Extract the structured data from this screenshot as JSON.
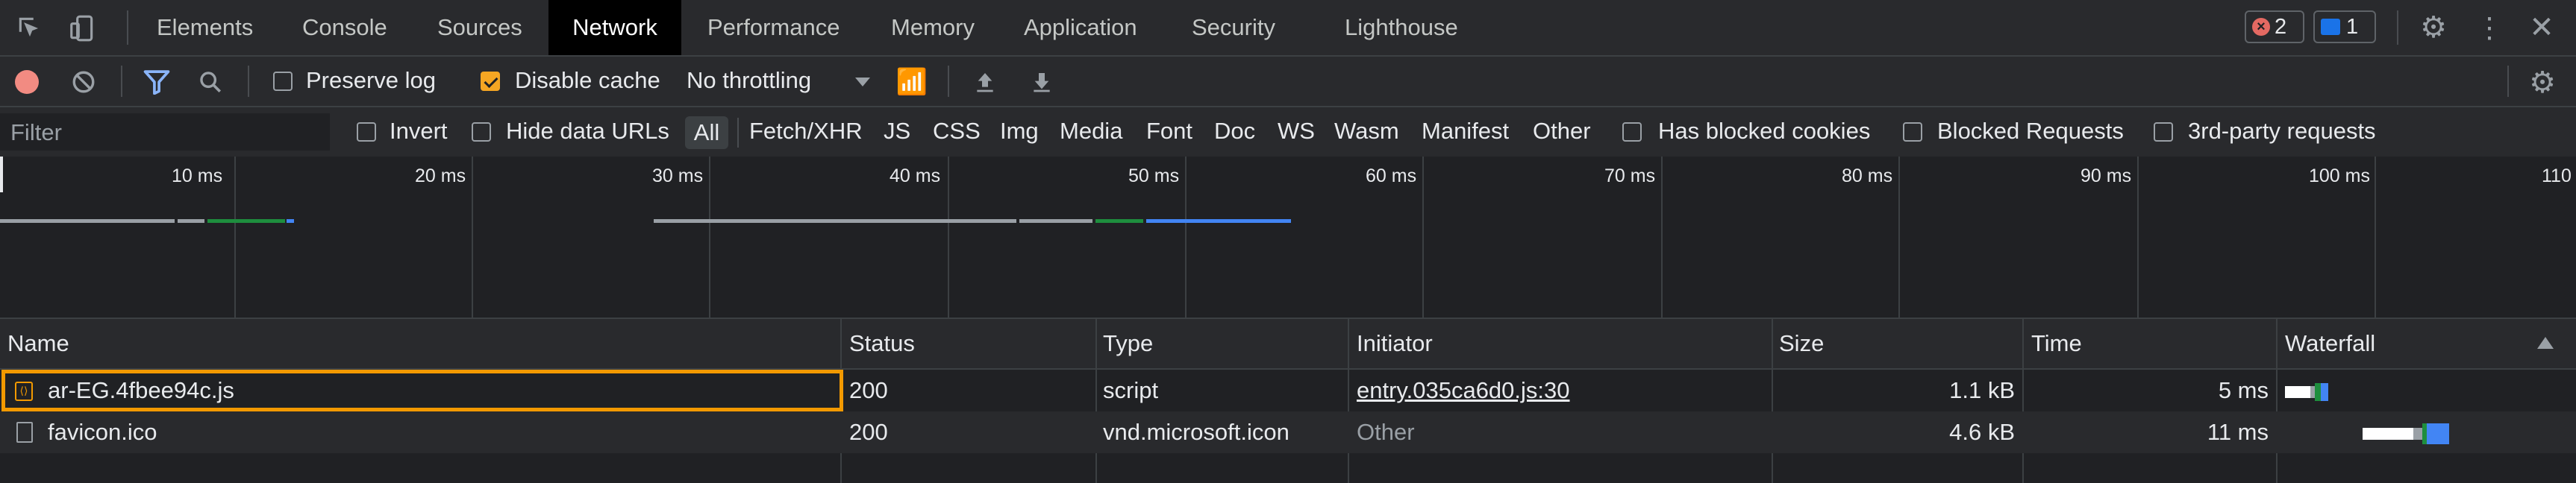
{
  "tabs": [
    "Elements",
    "Console",
    "Sources",
    "Network",
    "Performance",
    "Memory",
    "Application",
    "Security",
    "Lighthouse"
  ],
  "active_tab": "Network",
  "badges": {
    "errors": "2",
    "messages": "1"
  },
  "toolbar": {
    "preserve_log": "Preserve log",
    "disable_cache": "Disable cache",
    "throttling": "No throttling"
  },
  "filterbar": {
    "filter_placeholder": "Filter",
    "invert": "Invert",
    "hide_data_urls": "Hide data URLs",
    "types": [
      "All",
      "Fetch/XHR",
      "JS",
      "CSS",
      "Img",
      "Media",
      "Font",
      "Doc",
      "WS",
      "Wasm",
      "Manifest",
      "Other"
    ],
    "has_blocked_cookies": "Has blocked cookies",
    "blocked_requests": "Blocked Requests",
    "third_party": "3rd-party requests"
  },
  "overview": {
    "ticks": [
      "10 ms",
      "20 ms",
      "30 ms",
      "40 ms",
      "50 ms",
      "60 ms",
      "70 ms",
      "80 ms",
      "90 ms",
      "100 ms",
      "110"
    ]
  },
  "table": {
    "columns": [
      "Name",
      "Status",
      "Type",
      "Initiator",
      "Size",
      "Time",
      "Waterfall"
    ],
    "rows": [
      {
        "name": "ar-EG.4fbee94c.js",
        "status": "200",
        "type": "script",
        "initiator": "entry.035ca6d0.js:30",
        "size": "1.1 kB",
        "time": "5 ms"
      },
      {
        "name": "favicon.ico",
        "status": "200",
        "type": "vnd.microsoft.icon",
        "initiator": "Other",
        "size": "4.6 kB",
        "time": "11 ms"
      }
    ]
  },
  "colors": {
    "accent": "#8ab4f8",
    "highlight": "#f29900",
    "record": "#f28b82"
  }
}
